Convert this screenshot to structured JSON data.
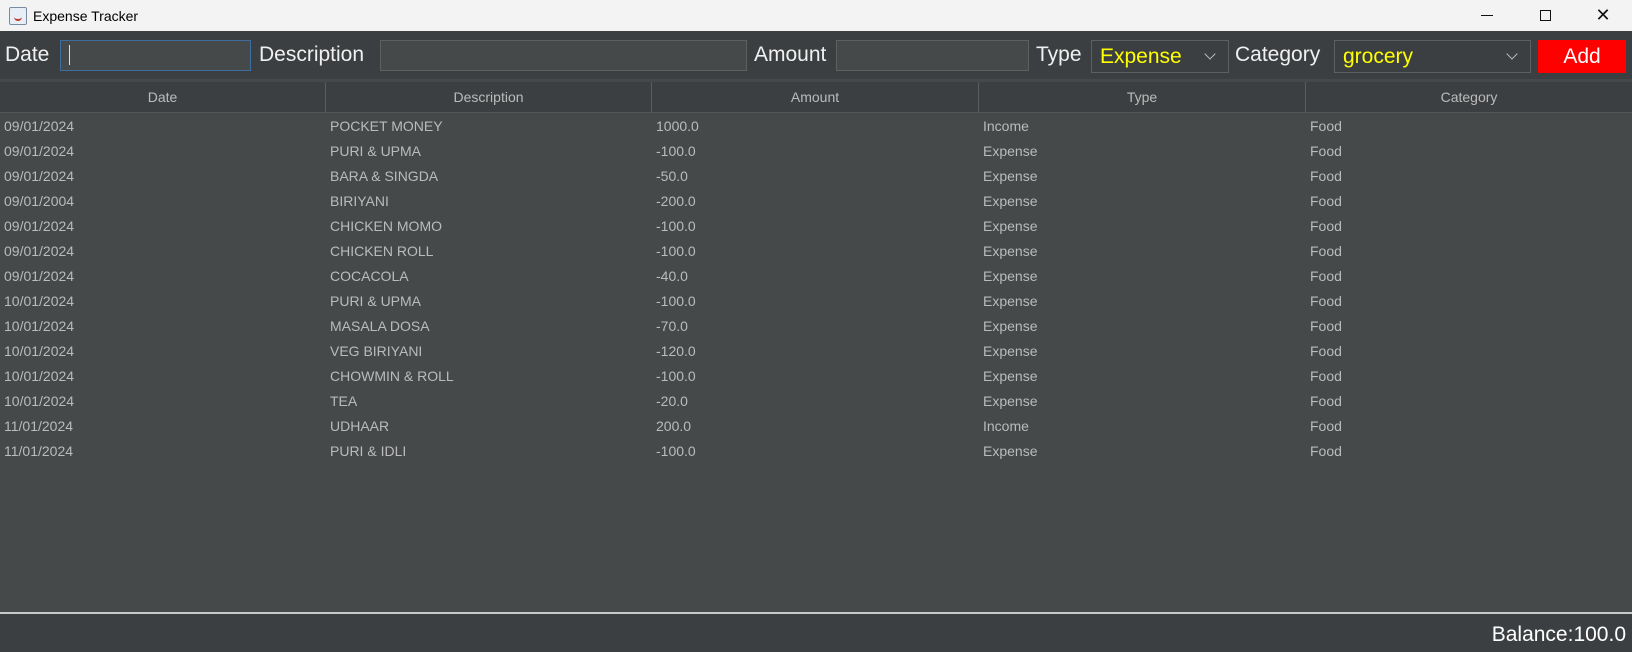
{
  "window": {
    "title": "Expense  Tracker"
  },
  "form": {
    "date_label": "Date",
    "date_value": "",
    "description_label": "Description",
    "description_value": "",
    "amount_label": "Amount",
    "amount_value": "",
    "type_label": "Type",
    "type_selected": "Expense",
    "category_label": "Category",
    "category_selected": "grocery",
    "add_label": "Add"
  },
  "table": {
    "columns": [
      "Date",
      "Description",
      "Amount",
      "Type",
      "Category"
    ],
    "rows": [
      [
        "09/01/2024",
        "POCKET MONEY",
        "1000.0",
        "Income",
        "Food"
      ],
      [
        "09/01/2024",
        "PURI & UPMA",
        "-100.0",
        "Expense",
        "Food"
      ],
      [
        "09/01/2024",
        "BARA & SINGDA",
        "-50.0",
        "Expense",
        "Food"
      ],
      [
        "09/01/2004",
        "BIRIYANI",
        "-200.0",
        "Expense",
        "Food"
      ],
      [
        "09/01/2024",
        "CHICKEN MOMO",
        "-100.0",
        "Expense",
        "Food"
      ],
      [
        "09/01/2024",
        "CHICKEN ROLL",
        "-100.0",
        "Expense",
        "Food"
      ],
      [
        "09/01/2024",
        "COCACOLA",
        "-40.0",
        "Expense",
        "Food"
      ],
      [
        "10/01/2024",
        "PURI & UPMA",
        "-100.0",
        "Expense",
        "Food"
      ],
      [
        "10/01/2024",
        "MASALA DOSA",
        "-70.0",
        "Expense",
        "Food"
      ],
      [
        "10/01/2024",
        "VEG BIRIYANI",
        "-120.0",
        "Expense",
        "Food"
      ],
      [
        "10/01/2024",
        "CHOWMIN & ROLL",
        "-100.0",
        "Expense",
        "Food"
      ],
      [
        "10/01/2024",
        "TEA",
        "-20.0",
        "Expense",
        "Food"
      ],
      [
        "11/01/2024",
        "UDHAAR",
        "200.0",
        "Income",
        "Food"
      ],
      [
        "11/01/2024",
        "PURI & IDLI",
        "-100.0",
        "Expense",
        "Food"
      ]
    ]
  },
  "status": {
    "balance": "Balance:100.0"
  },
  "colors": {
    "background": "#45494a",
    "combo_text": "#ffff00",
    "add_button": "#ff0000"
  }
}
